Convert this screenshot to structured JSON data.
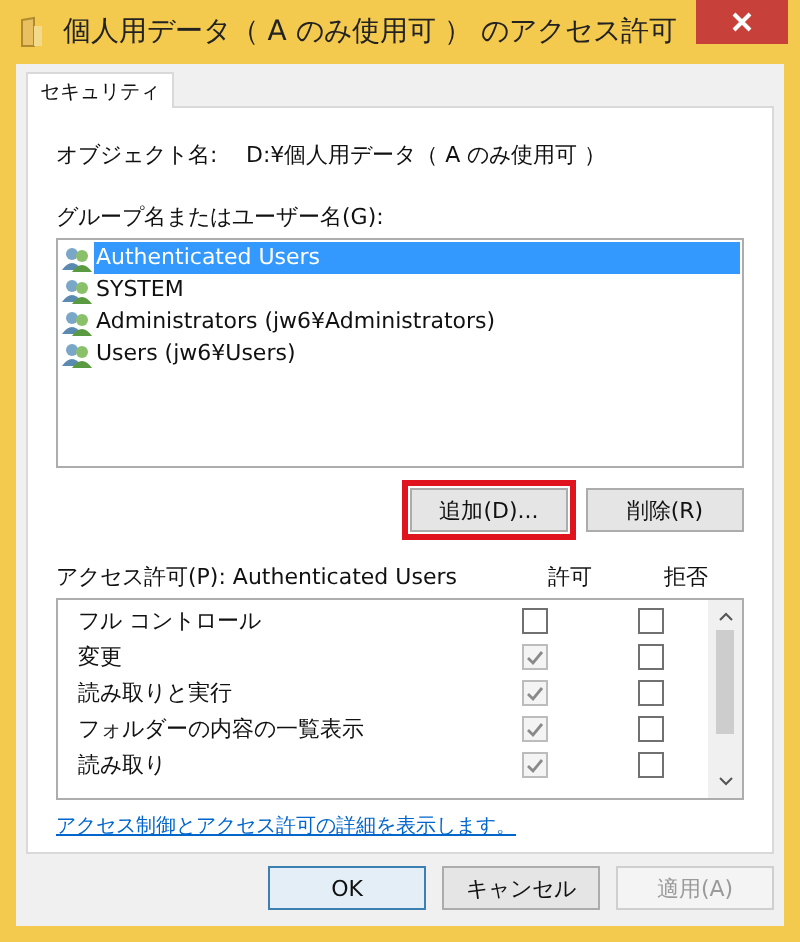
{
  "window": {
    "title": "個人用データ（ A のみ使用可 ） のアクセス許可"
  },
  "tabs": [
    {
      "label": "セキュリティ",
      "selected": true
    }
  ],
  "object": {
    "label": "オブジェクト名:",
    "value": "D:¥個人用データ（ A のみ使用可 ）"
  },
  "groups": {
    "label": "グループ名またはユーザー名(G):",
    "items": [
      {
        "name": "Authenticated Users",
        "selected": true
      },
      {
        "name": "SYSTEM",
        "selected": false
      },
      {
        "name": "Administrators (jw6¥Administrators)",
        "selected": false
      },
      {
        "name": "Users (jw6¥Users)",
        "selected": false
      }
    ]
  },
  "group_buttons": [
    {
      "label": "追加(D)...",
      "highlighted": true
    },
    {
      "label": "削除(R)",
      "highlighted": false
    }
  ],
  "permissions": {
    "label": "アクセス許可(P): Authenticated Users",
    "allow_header": "許可",
    "deny_header": "拒否",
    "rows": [
      {
        "name": "フル コントロール",
        "allow_checked": false,
        "allow_disabled": false,
        "deny_checked": false
      },
      {
        "name": "変更",
        "allow_checked": true,
        "allow_disabled": true,
        "deny_checked": false
      },
      {
        "name": "読み取りと実行",
        "allow_checked": true,
        "allow_disabled": true,
        "deny_checked": false
      },
      {
        "name": "フォルダーの内容の一覧表示",
        "allow_checked": true,
        "allow_disabled": true,
        "deny_checked": false
      },
      {
        "name": "読み取り",
        "allow_checked": true,
        "allow_disabled": true,
        "deny_checked": false
      }
    ]
  },
  "link": "アクセス制御とアクセス許可の詳細を表示します。",
  "buttons": [
    {
      "label": "OK",
      "default": true,
      "disabled": false
    },
    {
      "label": "キャンセル",
      "default": false,
      "disabled": false
    },
    {
      "label": "適用(A)",
      "default": false,
      "disabled": true
    }
  ]
}
